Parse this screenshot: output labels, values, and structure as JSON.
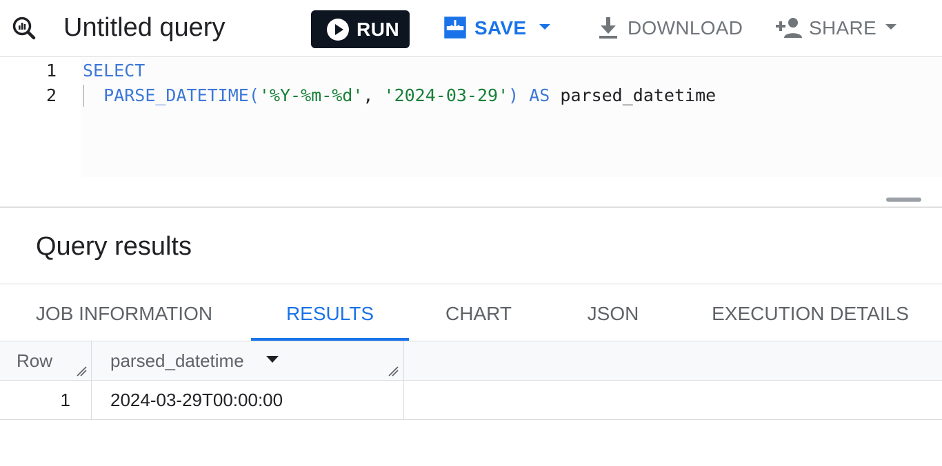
{
  "toolbar": {
    "app_icon": "query-magnifier-icon",
    "title": "Untitled query",
    "run_label": "RUN",
    "save_label": "SAVE",
    "download_label": "DOWNLOAD",
    "share_label": "SHARE"
  },
  "editor": {
    "lines": [
      {
        "number": "1",
        "tokens": [
          {
            "text": "SELECT",
            "kind": "kw"
          }
        ]
      },
      {
        "number": "2",
        "tokens": [
          {
            "text": "  ",
            "kind": "ident"
          },
          {
            "text": "PARSE_DATETIME(",
            "kind": "fn"
          },
          {
            "text": "'%Y-%m-%d'",
            "kind": "str"
          },
          {
            "text": ", ",
            "kind": "ident"
          },
          {
            "text": "'2024-03-29'",
            "kind": "str"
          },
          {
            "text": ") ",
            "kind": "fn"
          },
          {
            "text": "AS",
            "kind": "kw"
          },
          {
            "text": " parsed_datetime",
            "kind": "ident"
          }
        ]
      }
    ]
  },
  "results": {
    "title": "Query results",
    "tabs": [
      {
        "label": "JOB INFORMATION",
        "active": false
      },
      {
        "label": "RESULTS",
        "active": true
      },
      {
        "label": "CHART",
        "active": false
      },
      {
        "label": "JSON",
        "active": false
      },
      {
        "label": "EXECUTION DETAILS",
        "active": false
      }
    ],
    "table": {
      "row_header": "Row",
      "columns": [
        "parsed_datetime"
      ],
      "rows": [
        {
          "row": "1",
          "cells": [
            "2024-03-29T00:00:00"
          ]
        }
      ]
    }
  },
  "colors": {
    "accent": "#1a73e8",
    "run_button": "#0d1520",
    "keyword": "#3c78d8",
    "string": "#188038",
    "muted": "#5f6368"
  }
}
